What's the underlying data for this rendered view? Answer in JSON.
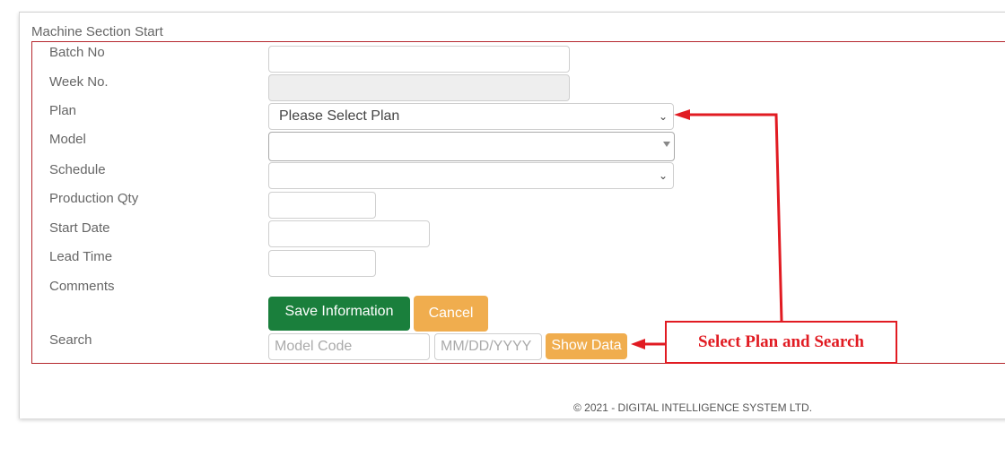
{
  "form": {
    "section_title": "Machine Section Start",
    "fields": {
      "batch_no": {
        "label": "Batch No",
        "value": ""
      },
      "week_no": {
        "label": "Week No.",
        "value": ""
      },
      "plan": {
        "label": "Plan",
        "selected": "Please Select Plan"
      },
      "model": {
        "label": "Model",
        "selected": ""
      },
      "schedule": {
        "label": "Schedule",
        "selected": ""
      },
      "production_qty": {
        "label": "Production Qty",
        "value": ""
      },
      "start_date": {
        "label": "Start Date",
        "value": ""
      },
      "lead_time": {
        "label": "Lead Time",
        "value": ""
      },
      "comments": {
        "label": "Comments"
      }
    },
    "buttons": {
      "save": "Save Information",
      "cancel": "Cancel"
    },
    "search": {
      "label": "Search",
      "model_code_placeholder": "Model Code",
      "date_placeholder": "MM/DD/YYYY",
      "show_data": "Show Data"
    }
  },
  "annotation": {
    "callout_text": "Select Plan and Search",
    "color": "#e11b22"
  },
  "footer": {
    "copyright": "© 2021 - DIGITAL INTELLIGENCE SYSTEM LTD."
  },
  "colors": {
    "save_button": "#1a7f3c",
    "warning_button": "#f0ad4e",
    "frame_border": "#b5272d"
  }
}
